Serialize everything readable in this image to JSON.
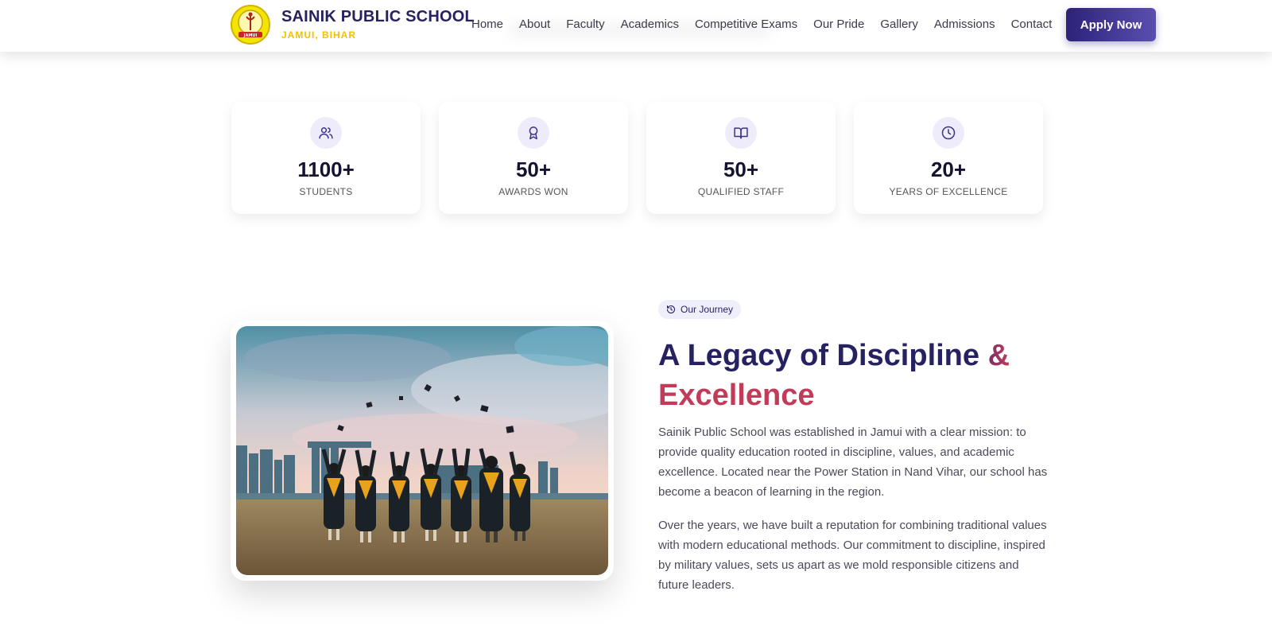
{
  "header": {
    "brand_name": "SAINIK PUBLIC SCHOOL",
    "brand_location": "JAMUI, BIHAR",
    "nav": [
      "Home",
      "About",
      "Faculty",
      "Academics",
      "Competitive Exams",
      "Our Pride",
      "Gallery",
      "Admissions",
      "Contact"
    ],
    "apply_label": "Apply Now",
    "logo_icon": "school-crest-icon"
  },
  "stats": [
    {
      "value": "1100+",
      "label": "STUDENTS",
      "icon": "users-icon"
    },
    {
      "value": "50+",
      "label": "AWARDS WON",
      "icon": "award-icon"
    },
    {
      "value": "50+",
      "label": "QUALIFIED STAFF",
      "icon": "book-icon"
    },
    {
      "value": "20+",
      "label": "YEARS OF EXCELLENCE",
      "icon": "clock-icon"
    }
  ],
  "journey": {
    "badge": "Our Journey",
    "heading_line1_a": "A Legacy of Discipline ",
    "heading_line1_b": "&",
    "heading_line2": "Excellence",
    "para1": "Sainik Public School was established in Jamui with a clear mission: to provide quality education rooted in discipline, values, and academic excellence. Located near the Power Station in Nand Vihar, our school has become a beacon of learning in the region.",
    "para2": "Over the years, we have built a reputation for combining traditional values with modern educational methods. Our commitment to discipline, inspired by military values, sets us apart as we mold responsible citizens and future leaders."
  },
  "colors": {
    "brand_navy": "#262262",
    "brand_yellow": "#f2c200",
    "accent_magenta": "#c23c5a",
    "icon_bg": "#eeecfa"
  }
}
